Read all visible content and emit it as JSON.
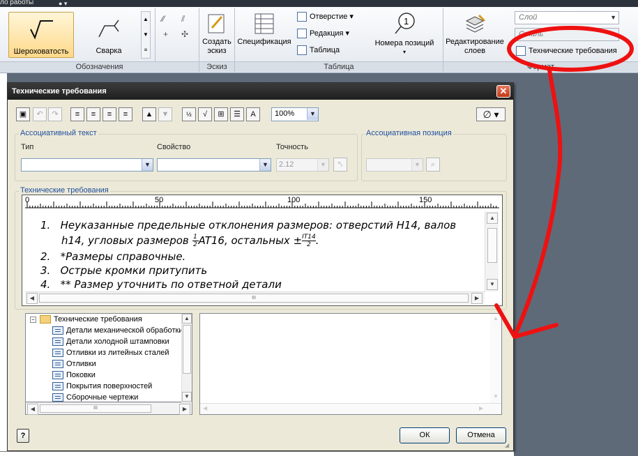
{
  "topbar": {
    "text": "ло работы"
  },
  "ribbon": {
    "roughness_label": "Шероховатость",
    "weld_label": "Сварка",
    "designations_panel": "Обозначения",
    "create_sketch_label_1": "Создать",
    "create_sketch_label_2": "эскиз",
    "sketch_panel": "Эскиз",
    "specification_label": "Спецификация",
    "hole_label": "Отверстие",
    "revision_label": "Редакция",
    "table_label": "Таблица",
    "table_panel": "Таблица",
    "position_numbers_label": "Номера позиций",
    "edit_layers_label_1": "Редактирование",
    "edit_layers_label_2": "слоев",
    "layer_combo": "Слой",
    "style_combo": "Стиль",
    "tech_req_label": "Технические требования",
    "format_panel": "Формат",
    "balloon_number": "1"
  },
  "dialog": {
    "title": "Технические требования",
    "close": "✕",
    "zoom": "100%",
    "diameter_symbol": "∅",
    "assoc_text_group": "Ассоциативный текст",
    "type_label": "Тип",
    "property_label": "Свойство",
    "precision_label": "Точность",
    "precision_value": "2.12",
    "assoc_pos_group": "Ассоциативная позиция",
    "tech_req_group": "Технические требования",
    "ruler": {
      "marks": [
        "0",
        "50",
        "100",
        "150"
      ]
    },
    "editor": {
      "l1_num": "1.",
      "l1_text": "Неуказанные предельные отклонения размеров: отверстий H14, валов",
      "l1b_a": "h14, угловых размеров ",
      "l1b_frac_num": "1",
      "l1b_frac_den": "2",
      "l1b_b": "AT16, остальных ±",
      "l1b_it_num": "IT14",
      "l1b_it_den": "2",
      "l1b_end": ".",
      "l2_num": "2.",
      "l2_text": "*Размеры справочные.",
      "l3_num": "3.",
      "l3_text": "Острые кромки притупить",
      "l4_num": "4.",
      "l4_text": "** Размер уточнить по ответной детали"
    },
    "scroll_mid": "III",
    "tree": {
      "root": "Технические требования",
      "items": [
        "Детали механической обработки",
        "Детали холодной штамповки",
        "Отливки из литейных сталей",
        "Отливки",
        "Поковки",
        "Покрытия поверхностей",
        "Сборочные чертежи"
      ]
    },
    "ok": "ОК",
    "cancel": "Отмена",
    "help": "?"
  }
}
